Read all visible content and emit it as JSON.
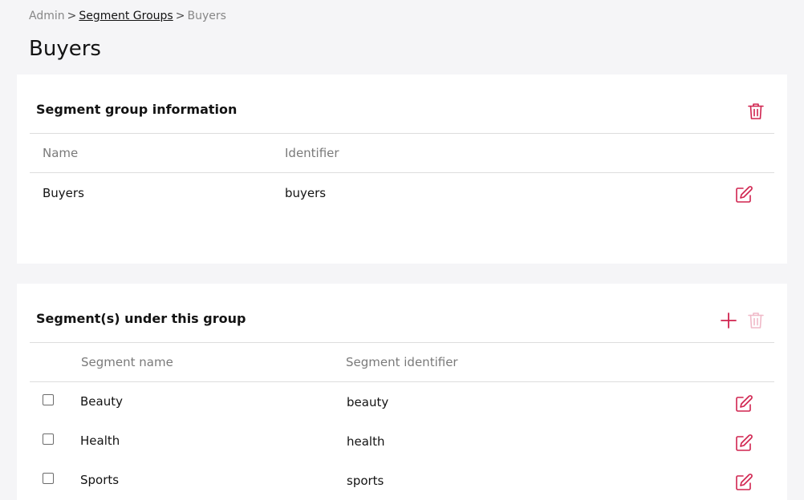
{
  "breadcrumb": {
    "root": "Admin",
    "separator": ">",
    "parent": "Segment Groups",
    "current": "Buyers"
  },
  "page": {
    "title": "Buyers"
  },
  "info_card": {
    "title": "Segment group information",
    "columns": {
      "name": "Name",
      "identifier": "Identifier"
    },
    "row": {
      "name": "Buyers",
      "identifier": "buyers"
    }
  },
  "segments_card": {
    "title": "Segment(s) under this group",
    "columns": {
      "name": "Segment name",
      "identifier": "Segment identifier"
    },
    "rows": [
      {
        "name": "Beauty",
        "identifier": "beauty",
        "checked": false
      },
      {
        "name": "Health",
        "identifier": "health",
        "checked": false
      },
      {
        "name": "Sports",
        "identifier": "sports",
        "checked": false
      }
    ]
  },
  "colors": {
    "accent": "#d0234f",
    "accent_disabled": "#f0b9c8",
    "background": "#f5f5f7",
    "card": "#ffffff"
  },
  "icons": {
    "delete": "trash-icon",
    "edit": "edit-icon",
    "add": "plus-icon"
  }
}
